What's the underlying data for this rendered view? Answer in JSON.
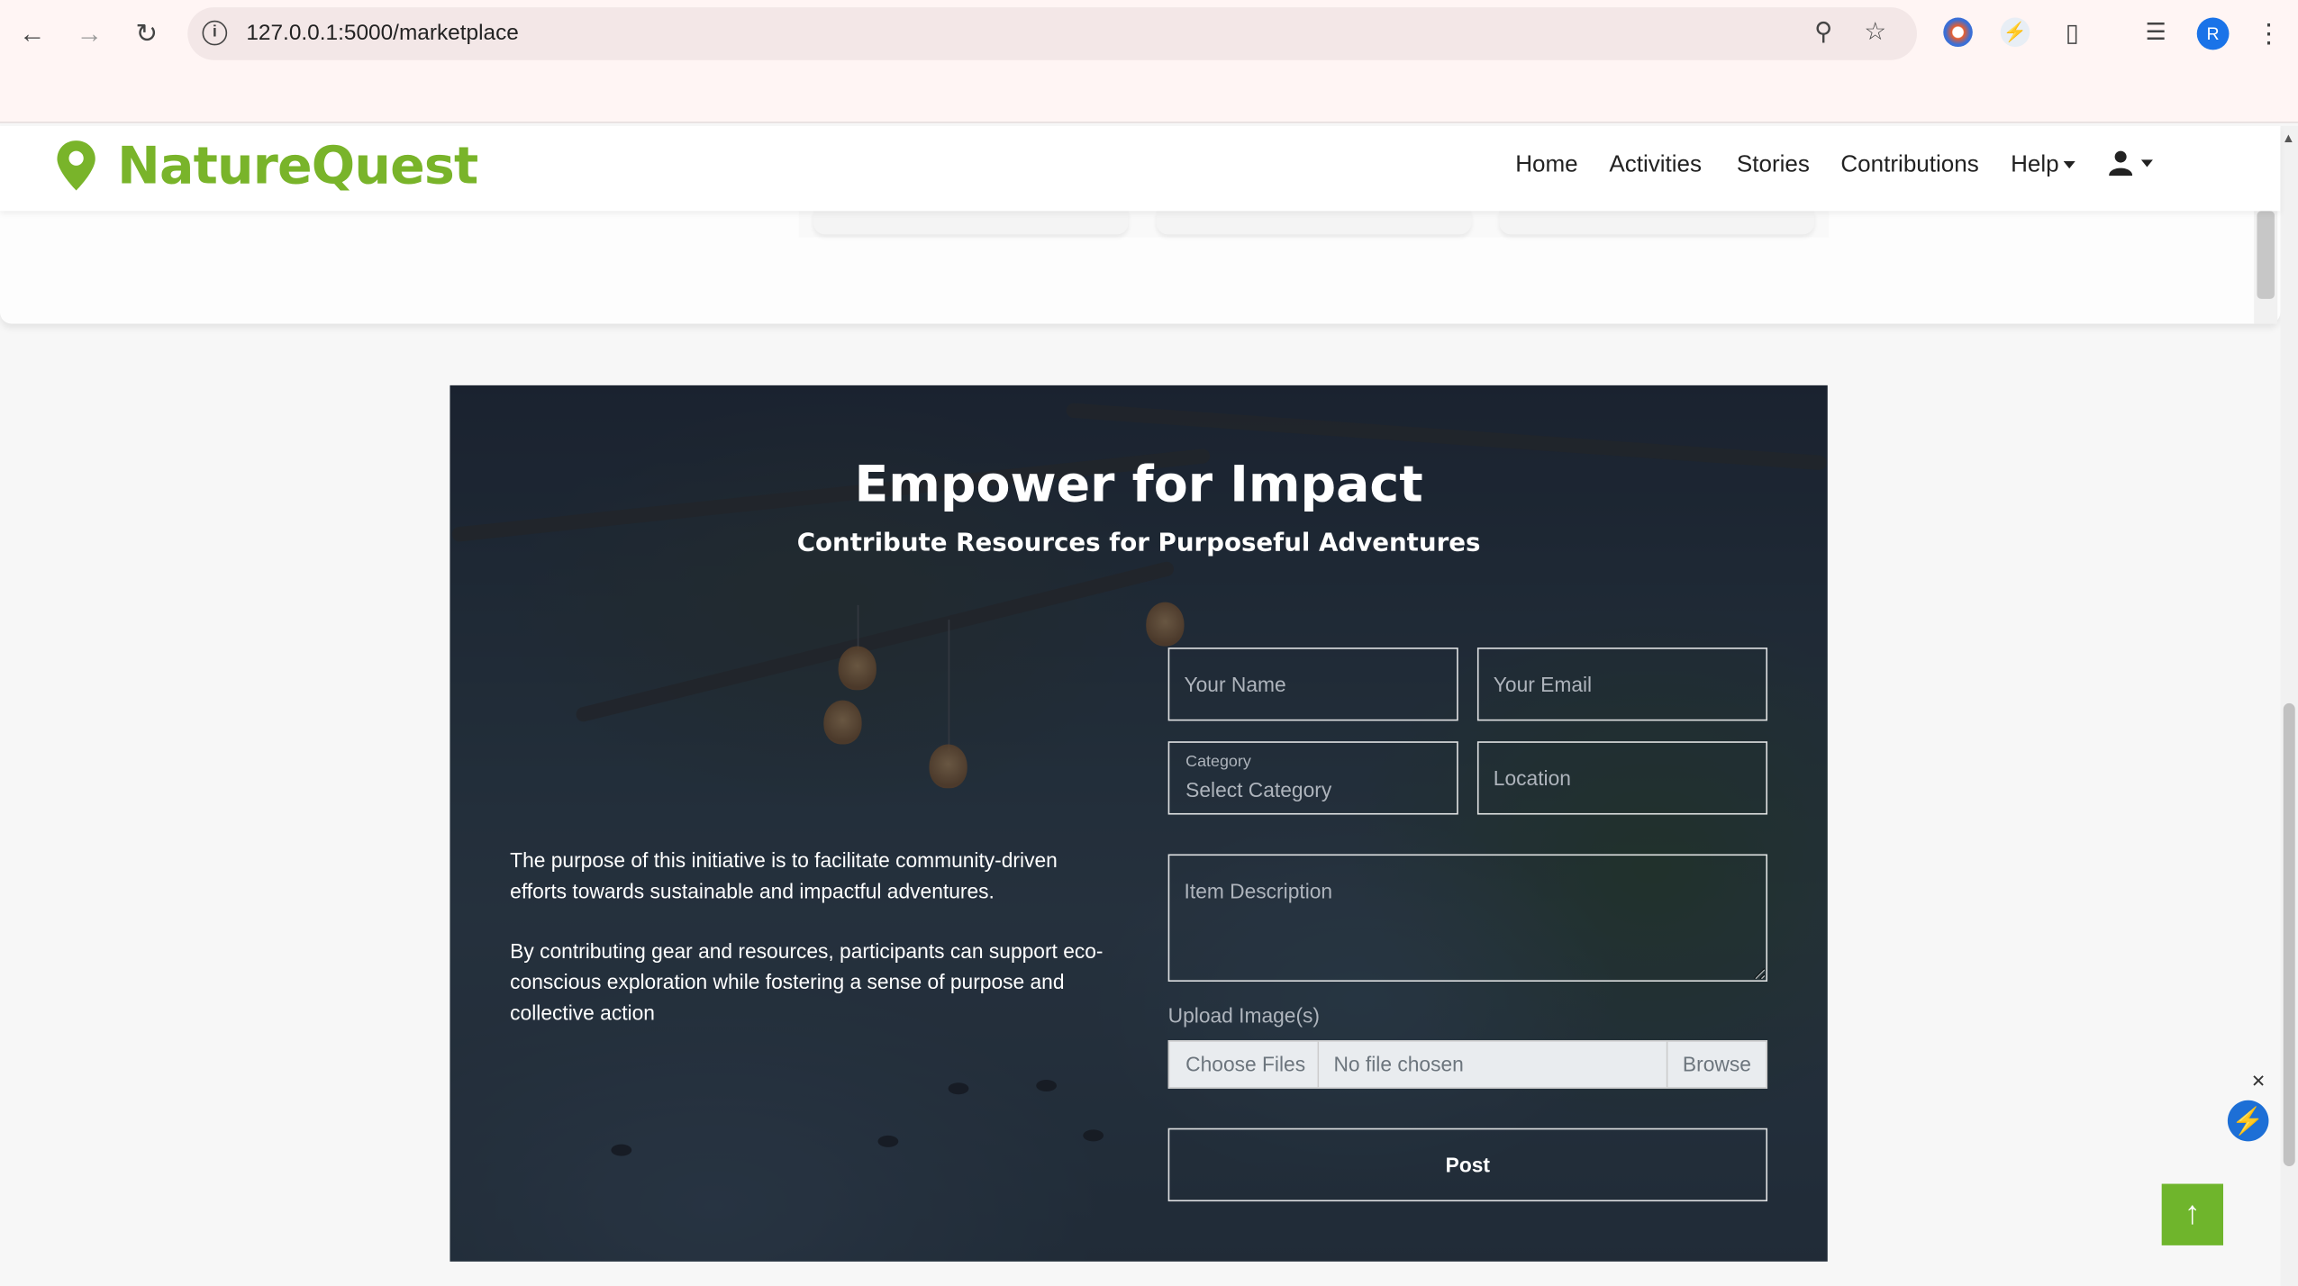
{
  "browser": {
    "url": "127.0.0.1:5000/marketplace",
    "profile_initial": "R"
  },
  "navbar": {
    "brand": "NatureQuest",
    "items": [
      {
        "label": "Home"
      },
      {
        "label": "Activities"
      },
      {
        "label": "Stories"
      },
      {
        "label": "Contributions"
      },
      {
        "label": "Help"
      }
    ]
  },
  "hero": {
    "title": "Empower for Impact",
    "subtitle": "Contribute Resources for Purposeful Adventures",
    "intro_p1": "The purpose of this initiative is to facilitate community-driven efforts towards sustainable and impactful adventures.",
    "intro_p2": "By contributing gear and resources, participants can support eco-conscious exploration while fostering a sense of purpose and collective action"
  },
  "form": {
    "name_placeholder": "Your Name",
    "email_placeholder": "Your Email",
    "category_label": "Category",
    "category_value": "Select Category",
    "location_placeholder": "Location",
    "description_placeholder": "Item Description",
    "upload_label": "Upload Image(s)",
    "choose_files": "Choose Files",
    "no_file": "No file chosen",
    "browse": "Browse",
    "submit": "Post"
  },
  "icons": {
    "back": "arrow-left-icon",
    "forward": "arrow-right-icon",
    "reload": "reload-icon",
    "brand": "map-pin-icon",
    "user": "user-icon",
    "to_top": "arrow-up-icon"
  },
  "colors": {
    "brand_green": "#79b42a",
    "to_top_green": "#6fb52c"
  }
}
